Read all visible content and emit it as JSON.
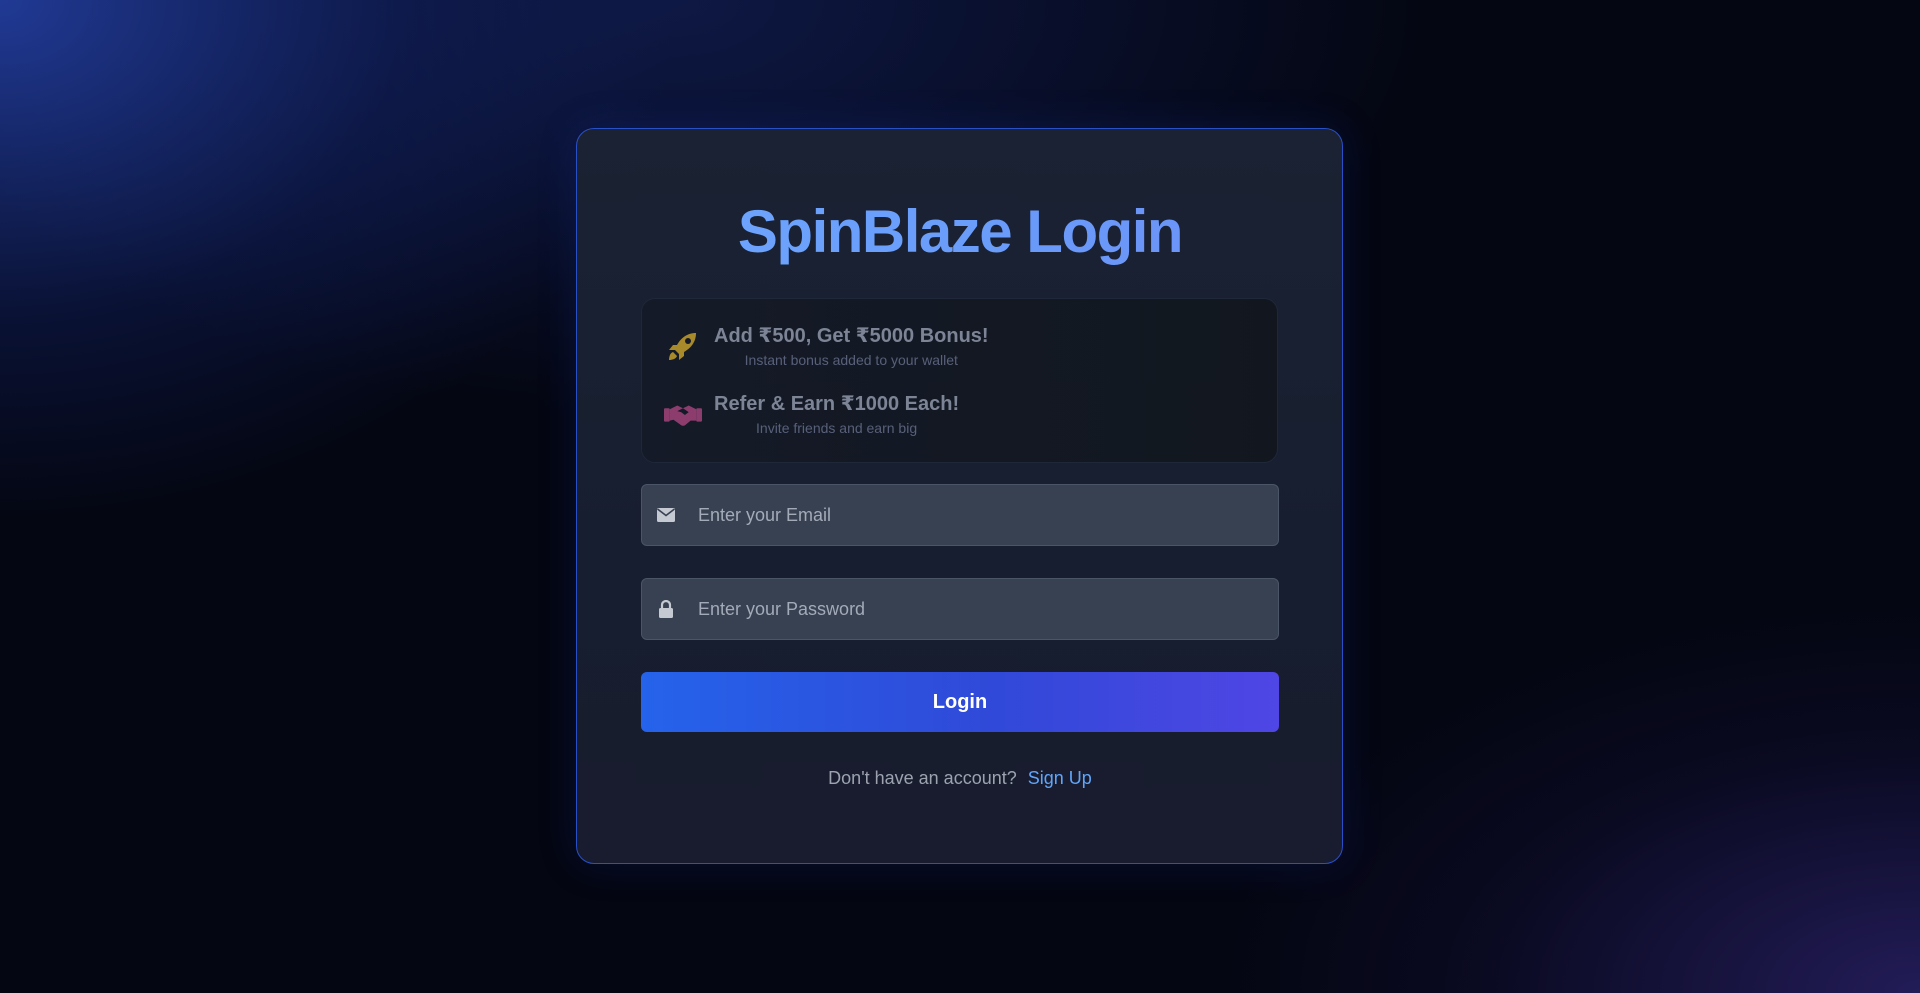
{
  "login": {
    "title": "SpinBlaze Login",
    "promos": [
      {
        "icon": "rocket-icon",
        "icon_color": "#a98a2a",
        "title": "Add ₹500, Get ₹5000 Bonus!",
        "subtitle": "Instant bonus added to your wallet"
      },
      {
        "icon": "handshake-icon",
        "icon_color": "#8c3d6e",
        "title": "Refer & Earn ₹1000 Each!",
        "subtitle": "Invite friends and earn big"
      }
    ],
    "email": {
      "icon": "envelope-icon",
      "placeholder": "Enter your Email",
      "value": ""
    },
    "password": {
      "icon": "lock-icon",
      "placeholder": "Enter your Password",
      "value": ""
    },
    "button_label": "Login",
    "signup_prompt": "Don't have an account?",
    "signup_link": "Sign Up"
  },
  "colors": {
    "accent_blue": "#2563eb",
    "accent_indigo": "#4f46e5",
    "link": "#60a5fa",
    "card_border": "#2a50c8"
  }
}
